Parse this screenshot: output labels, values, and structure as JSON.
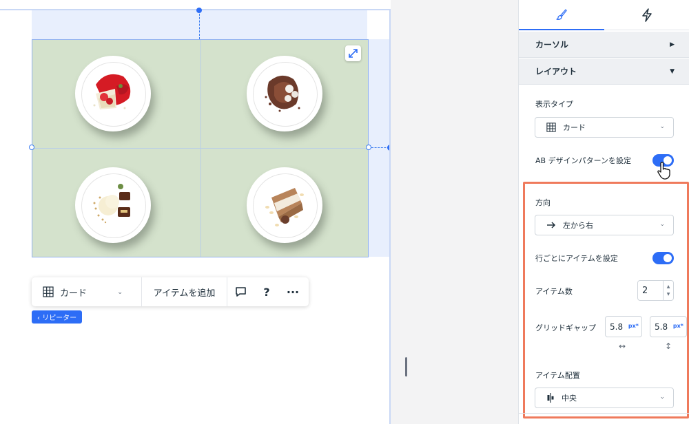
{
  "toolbar": {
    "layout_label": "カード",
    "add_item_label": "アイテムを追加",
    "help_label": "?",
    "more_label": "···"
  },
  "repeater_tag": "‹ リピーター",
  "panel": {
    "sections": {
      "cursor": "カーソル",
      "layout": "レイアウト"
    },
    "display_type": {
      "label": "表示タイプ",
      "value": "カード"
    },
    "ab_pattern": {
      "label": "AB デザインパターンを設定",
      "enabled": true
    },
    "direction": {
      "label": "方向",
      "value": "左から右"
    },
    "items_per_row": {
      "label": "行ごとにアイテムを設定",
      "enabled": true
    },
    "item_count": {
      "label": "アイテム数",
      "value": "2"
    },
    "grid_gap": {
      "label": "グリッドギャップ",
      "horizontal": "5.8",
      "vertical": "5.8",
      "unit": "px*"
    },
    "item_alignment": {
      "label": "アイテム配置",
      "value": "中央"
    }
  },
  "colors": {
    "accent": "#2d6df6",
    "highlight": "#ef7a5c",
    "repeater_bg": "#d4e2cc"
  }
}
